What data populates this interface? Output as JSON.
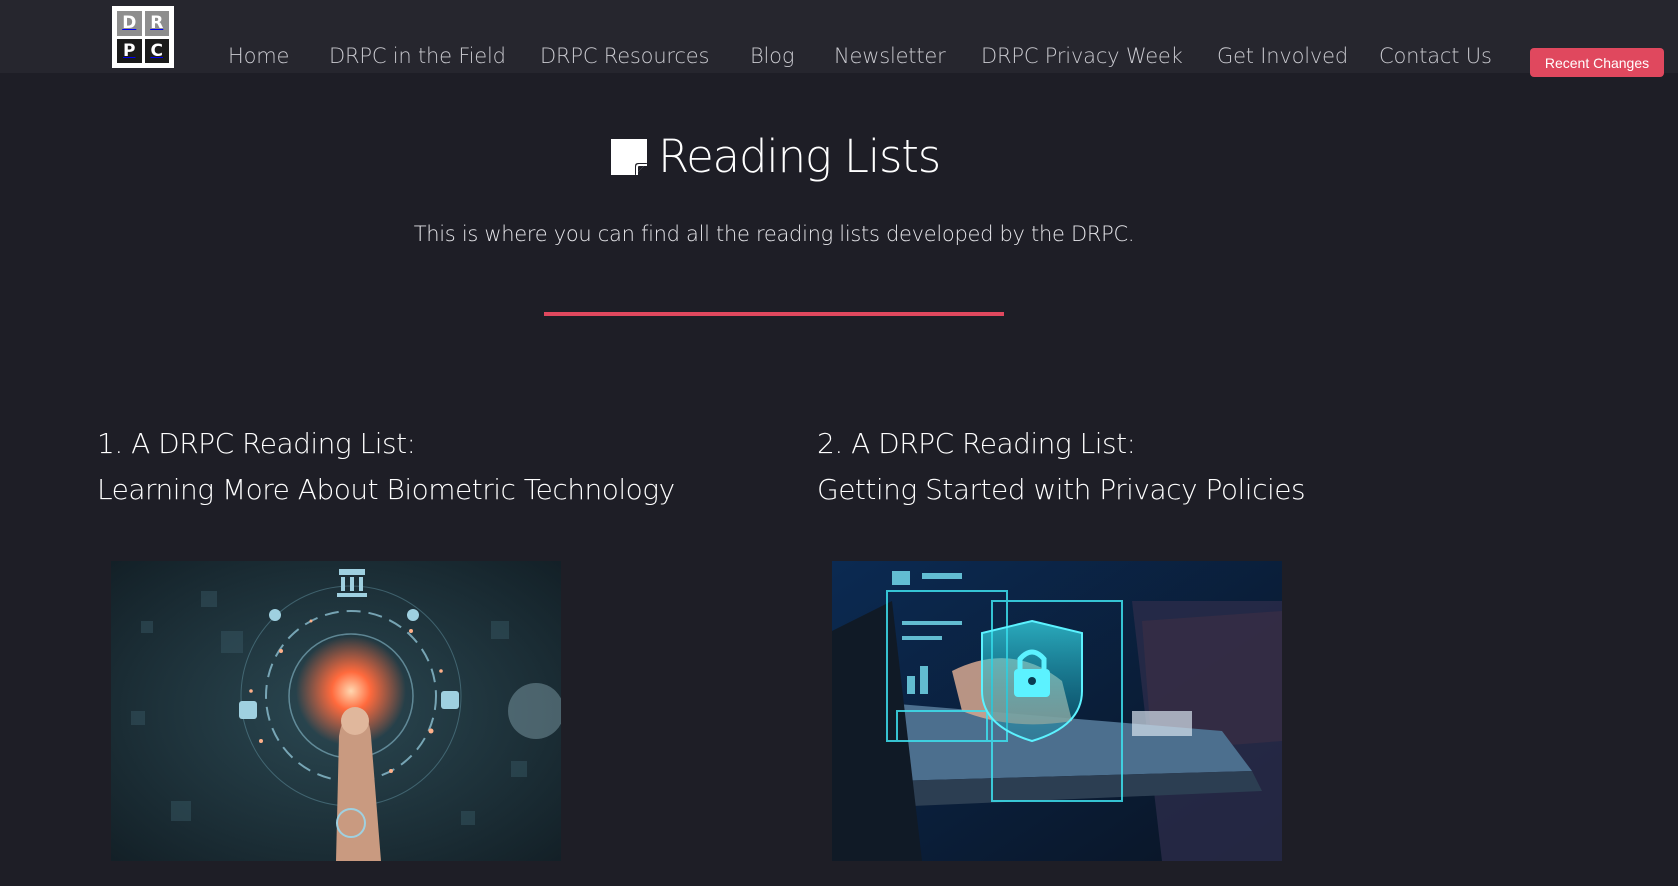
{
  "logo": {
    "letters": [
      "D",
      "R",
      "P",
      "C"
    ]
  },
  "nav": {
    "items": [
      {
        "label": "Home"
      },
      {
        "label": "DRPC in the Field"
      },
      {
        "label": "DRPC Resources"
      },
      {
        "label": "Blog"
      },
      {
        "label": "Newsletter"
      },
      {
        "label": "DRPC Privacy Week"
      },
      {
        "label": "Get Involved"
      },
      {
        "label": "Contact Us"
      }
    ],
    "recent_changes_label": "Recent Changes"
  },
  "hero": {
    "icon": "sticky-note-icon",
    "title": "Reading Lists",
    "subtitle": "This is where you can find all the reading lists developed by the DRPC."
  },
  "cards": [
    {
      "line1": "1. A DRPC Reading List:",
      "line2": "Learning More About Biometric Technology",
      "image": "fingerprint-biometric-image"
    },
    {
      "line1": "2. A DRPC Reading List:",
      "line2": "Getting Started with Privacy Policies",
      "image": "laptop-padlock-security-image"
    }
  ],
  "colors": {
    "background": "#1e1e26",
    "header": "#26262e",
    "accent": "#e0485e",
    "nav_text": "#c9c9cf"
  }
}
